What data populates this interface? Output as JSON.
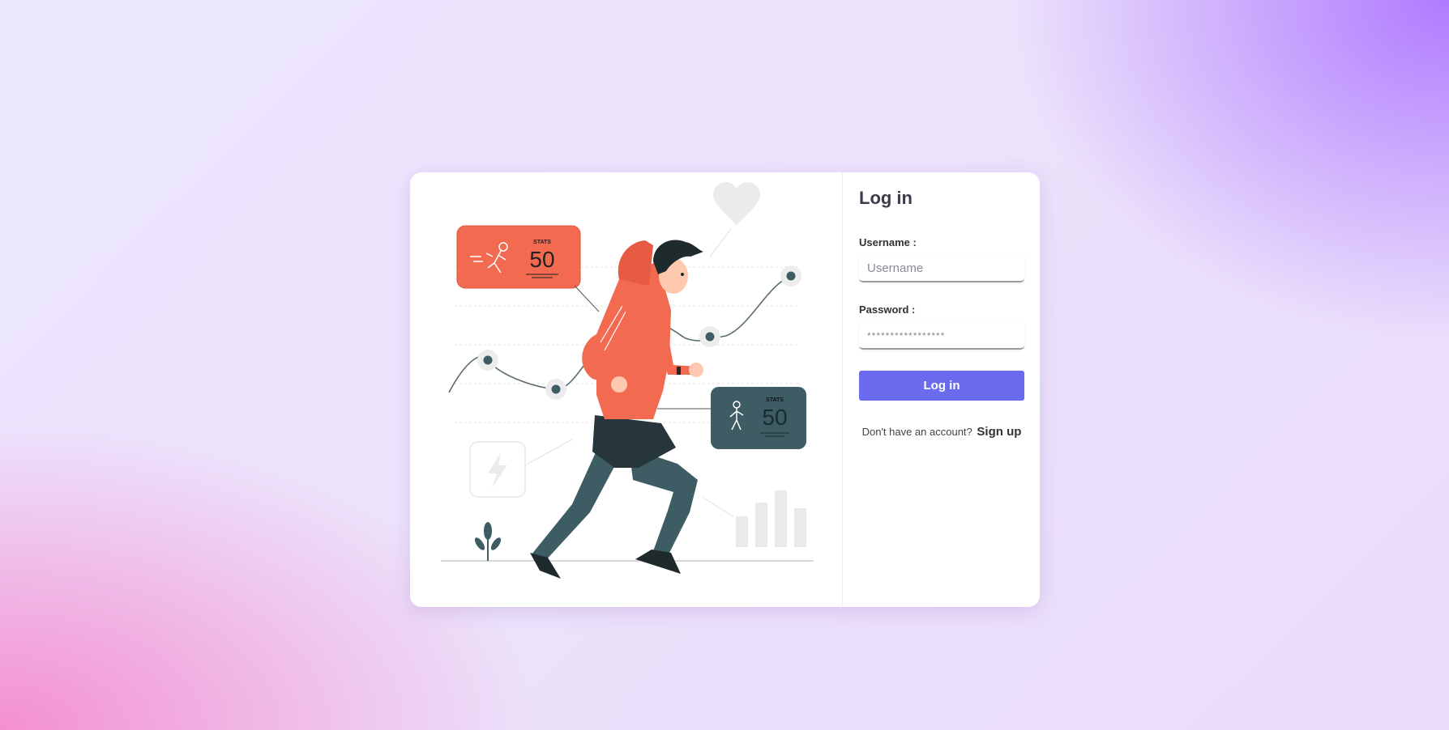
{
  "illustration": {
    "card_left": {
      "caption": "STATS",
      "value": "50"
    },
    "card_right": {
      "caption": "STATS",
      "value": "50"
    }
  },
  "form": {
    "title": "Log in",
    "username_label": "Username :",
    "username_placeholder": "Username",
    "password_label": "Password :",
    "password_placeholder": "*****************",
    "login_button": "Log in",
    "signup_prompt": "Don't have an account?",
    "signup_link": "Sign up"
  },
  "colors": {
    "accent": "#6b6bef",
    "stats_card_orange": "#f26b51",
    "stats_card_dark": "#3d5c63"
  }
}
